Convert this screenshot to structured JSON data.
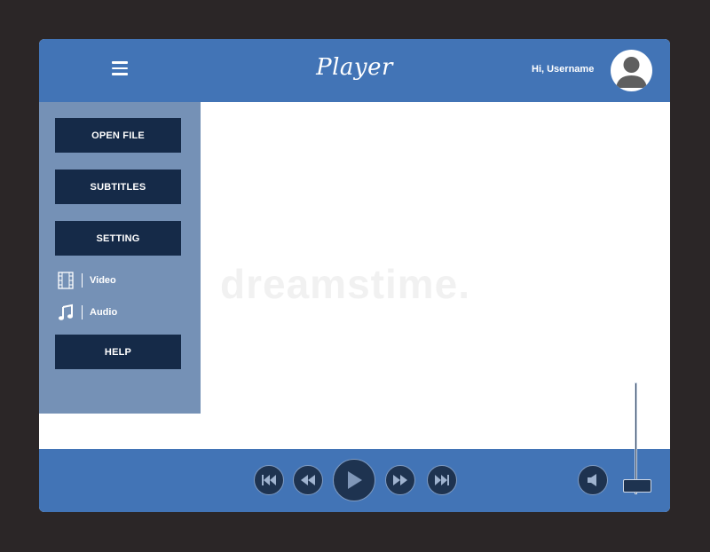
{
  "header": {
    "title": "Player",
    "greeting": "Hi, Username",
    "menu_icon": "hamburger-menu-icon",
    "avatar_icon": "user-avatar-icon"
  },
  "sidebar": {
    "buttons": [
      {
        "label": "OPEN FILE"
      },
      {
        "label": "SUBTITLES"
      },
      {
        "label": "SETTING"
      }
    ],
    "items": [
      {
        "label": "Video",
        "icon": "film-icon"
      },
      {
        "label": "Audio",
        "icon": "music-note-icon"
      }
    ],
    "help_label": "HELP"
  },
  "watermark": "dreamstime.",
  "controls": {
    "buttons": [
      {
        "icon": "skip-previous-icon"
      },
      {
        "icon": "rewind-icon"
      },
      {
        "icon": "play-icon"
      },
      {
        "icon": "fast-forward-icon"
      },
      {
        "icon": "skip-next-icon"
      },
      {
        "icon": "volume-icon"
      }
    ]
  },
  "colors": {
    "background": "#2b2627",
    "header": "#4274b6",
    "sidebar": "#7591b6",
    "button": "#152a48",
    "content": "#ffffff"
  }
}
